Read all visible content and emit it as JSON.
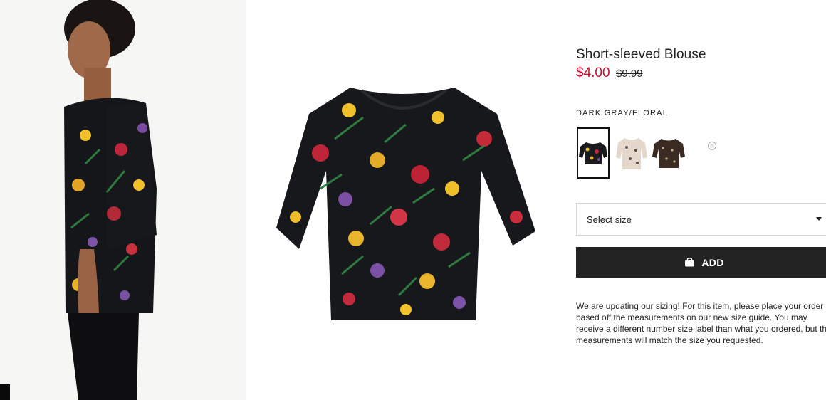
{
  "product": {
    "title": "Short-sleeved Blouse",
    "sale_price": "$4.00",
    "original_price": "$9.99",
    "color_name": "DARK GRAY/FLORAL"
  },
  "swatches": [
    {
      "name": "dark-gray-floral",
      "selected": true
    },
    {
      "name": "beige-pattern",
      "selected": false
    },
    {
      "name": "brown-pattern",
      "selected": false
    }
  ],
  "size_select": {
    "label": "Select size",
    "icon": "chevron-down-icon"
  },
  "add_button": {
    "label": "ADD",
    "icon": "shopping-bag-icon"
  },
  "sizing_note": "We are updating our sizing! For this item, please place your order based off the measurements on our new size guide. You may receive a different number size label than what you ordered, but the measurements will match the size you requested.",
  "colors": {
    "sale": "#c8102e",
    "button": "#222222",
    "text": "#222222"
  }
}
